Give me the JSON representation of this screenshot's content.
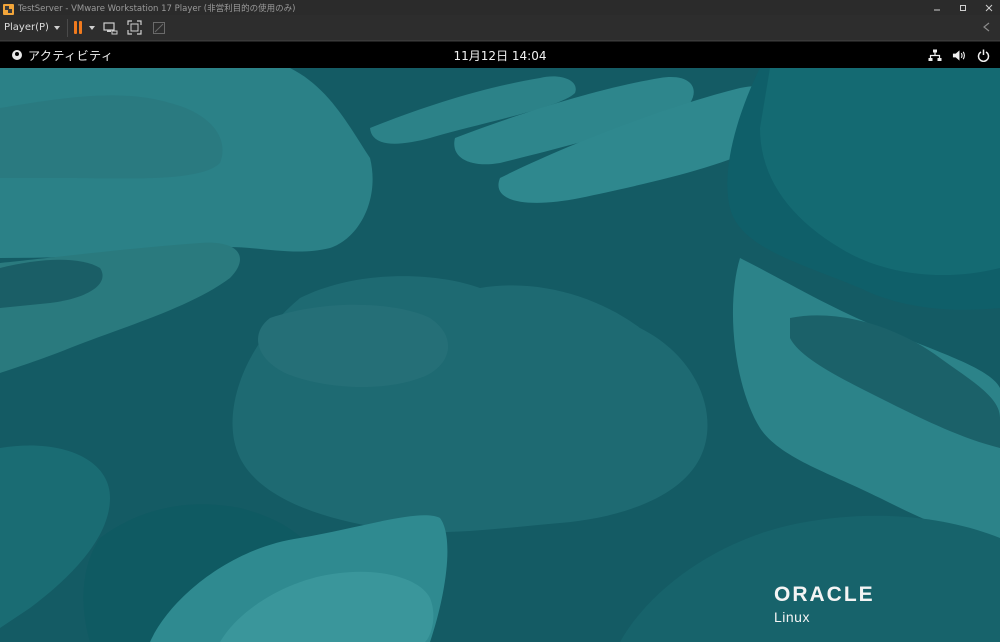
{
  "window": {
    "title": "TestServer - VMware Workstation 17 Player (非営利目的の使用のみ)",
    "icon": "vmware-player-icon"
  },
  "toolbar": {
    "player_menu_label": "Player(P)",
    "pause_color": "#f07a1e",
    "icons": [
      "pause-icon",
      "send-ctrl-alt-del-icon",
      "fullscreen-icon",
      "unity-icon",
      "collapse-toolbar-icon"
    ]
  },
  "guest_topbar": {
    "activities_label": "アクティビティ",
    "clock": "11月12日  14:04",
    "tray_icons": [
      "network-icon",
      "volume-icon",
      "power-icon"
    ]
  },
  "desktop": {
    "background_color": "#14606a",
    "logo": {
      "brand": "ORACLE",
      "product": "Linux"
    }
  }
}
